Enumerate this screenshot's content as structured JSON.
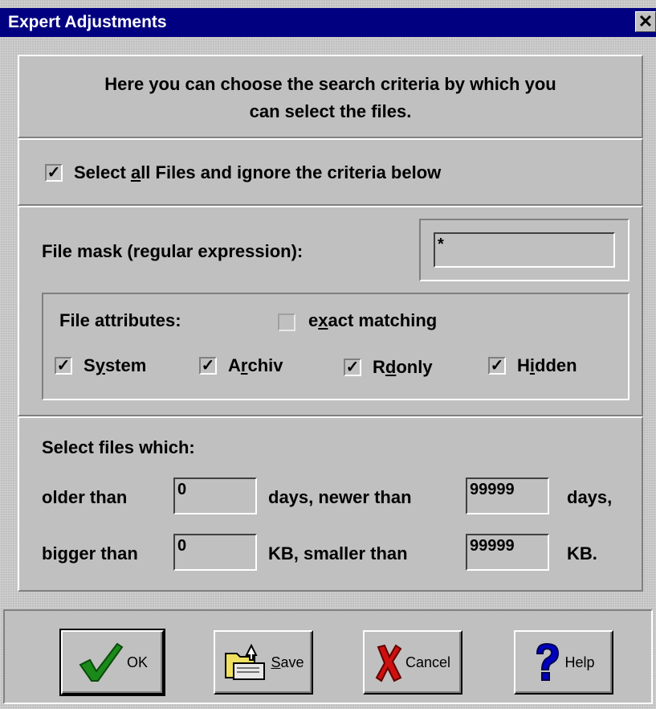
{
  "window": {
    "title": "Expert Adjustments",
    "close_glyph": "✕"
  },
  "intro": {
    "line1": "Here you can choose the search criteria by which you",
    "line2": "can select the files."
  },
  "select_all": {
    "checked": true,
    "label_pre": "Select ",
    "label_ul": "a",
    "label_post": "ll Files and ignore the criteria below"
  },
  "file_mask": {
    "label": "File mask (regular expression):",
    "value": "*"
  },
  "attributes": {
    "label": "File attributes:",
    "exact_matching": {
      "checked": false,
      "pre": "e",
      "ul": "x",
      "post": "act matching"
    },
    "system": {
      "checked": true,
      "pre": "S",
      "ul": "y",
      "post": "stem"
    },
    "archiv": {
      "checked": true,
      "pre": "A",
      "ul": "r",
      "post": "chiv"
    },
    "rdonly": {
      "checked": true,
      "pre": "R",
      "ul": "d",
      "post": "only"
    },
    "hidden": {
      "checked": true,
      "pre": "H",
      "ul": "i",
      "post": "dden"
    }
  },
  "criteria": {
    "heading": "Select files which:",
    "older_than_label": "older than",
    "older_than_value": "0",
    "newer_than_label": "days, newer than",
    "newer_than_value": "99999",
    "days_suffix": "days,",
    "bigger_than_label": "bigger than",
    "bigger_than_value": "0",
    "smaller_than_label": "KB, smaller than",
    "smaller_than_value": "99999",
    "kb_suffix": "KB."
  },
  "buttons": {
    "ok": {
      "label": "OK",
      "icon": "checkmark-icon"
    },
    "save": {
      "pre": "",
      "ul": "S",
      "post": "ave",
      "icon": "save-folder-icon"
    },
    "cancel": {
      "label": "Cancel",
      "icon": "red-x-icon"
    },
    "help": {
      "label": "Help",
      "icon": "question-mark-icon"
    }
  },
  "colors": {
    "titlebar": "#000080",
    "face": "#c0c0c0",
    "ok_check": "#1a8a1a",
    "cancel_x": "#d01010",
    "help_q": "#0000c0"
  }
}
